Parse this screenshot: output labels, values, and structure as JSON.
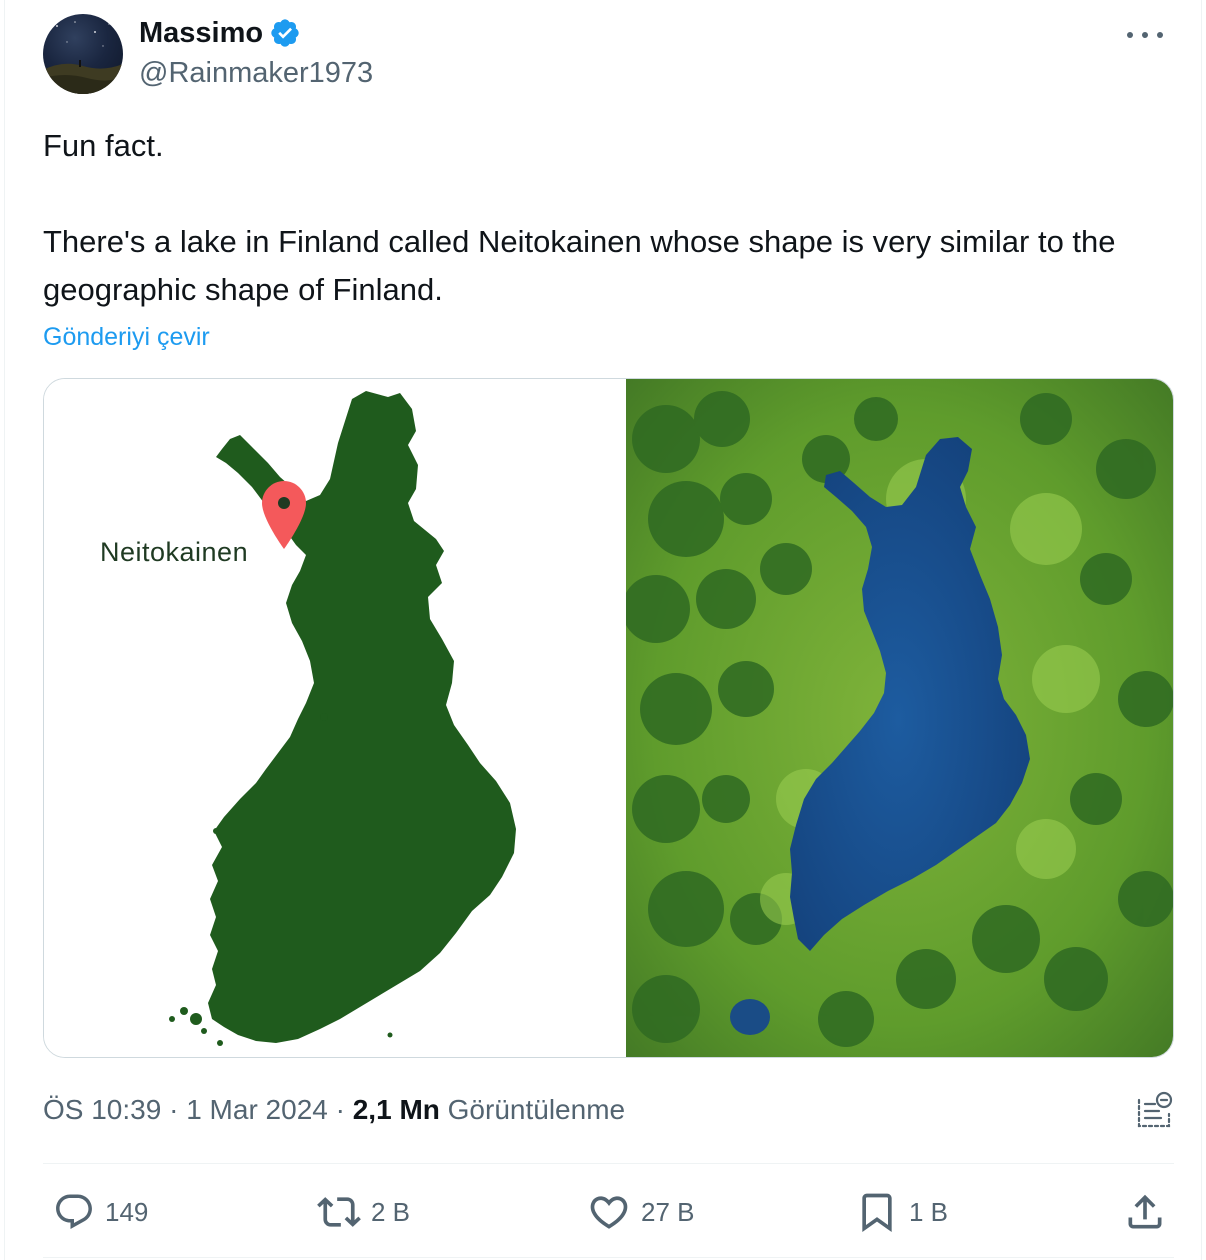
{
  "author": {
    "name": "Massimo",
    "handle": "@Rainmaker1973",
    "verified": true
  },
  "tweet": {
    "line1": "Fun fact.",
    "line2": "There's a lake in Finland called Neitokainen whose shape is very similar to the geographic shape of Finland.",
    "translate_label": "Gönderiyi çevir"
  },
  "media": {
    "map_label": "Neitokainen",
    "map_color": "#1f5b1d",
    "pin_color": "#f4595b",
    "lake_color": "#1c4f8c",
    "forest_color": "#5c9a2c"
  },
  "meta": {
    "time": "ÖS 10:39",
    "date": "1 Mar 2024",
    "views_count": "2,1 Mn",
    "views_label": "Görüntülenme"
  },
  "actions": {
    "replies": "149",
    "reposts": "2 B",
    "likes": "27 B",
    "bookmarks": "1 B"
  },
  "colors": {
    "accent": "#1d9bf0",
    "text": "#0f1419",
    "secondary": "#536471"
  }
}
